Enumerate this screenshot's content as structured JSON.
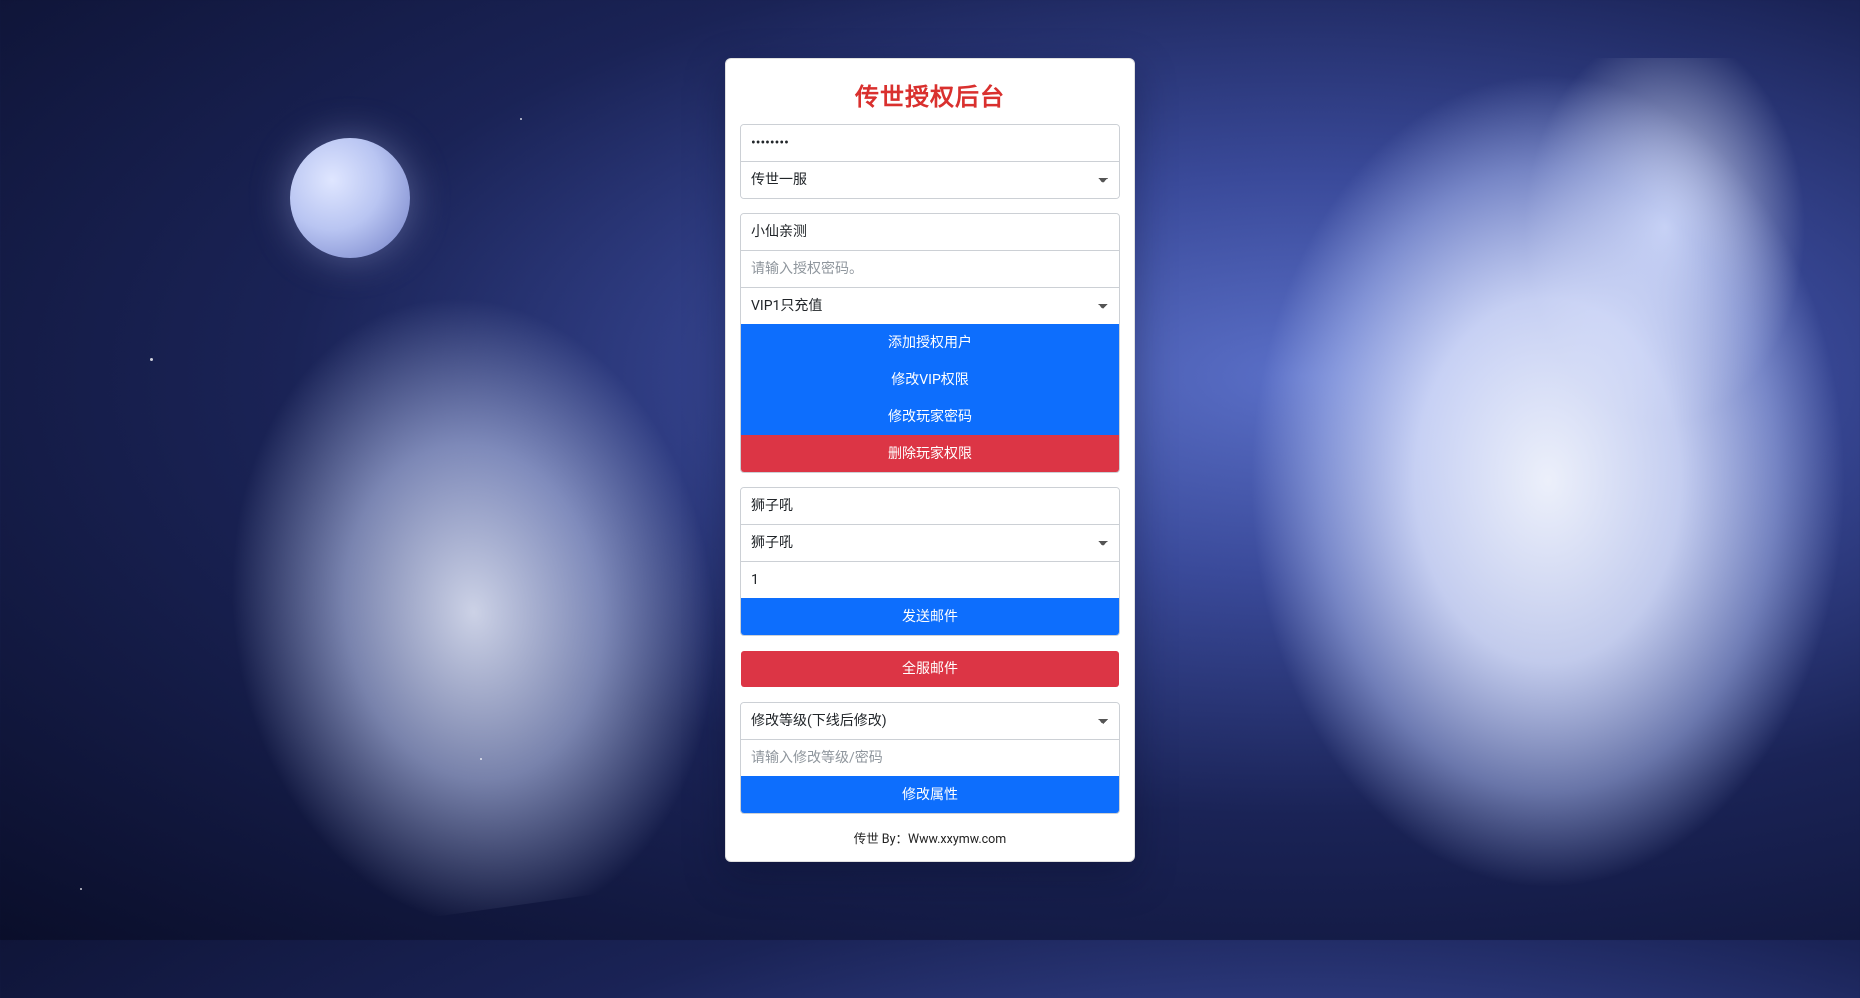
{
  "title": "传世授权后台",
  "section1": {
    "password_value": "••••••••",
    "server_select_value": "传世一服"
  },
  "section2": {
    "name_value": "小仙亲测",
    "auth_password_placeholder": "请输入授权密码。",
    "vip_select_value": "VIP1只充值",
    "btn_add_user": "添加授权用户",
    "btn_modify_vip": "修改VIP权限",
    "btn_change_pw": "修改玩家密码",
    "btn_delete_perm": "删除玩家权限"
  },
  "section3": {
    "item_name_value": "狮子吼",
    "item_select_value": "狮子吼",
    "qty_value": "1",
    "btn_send_mail": "发送邮件"
  },
  "section4": {
    "btn_global_mail": "全服邮件"
  },
  "section5": {
    "attr_select_value": "修改等级(下线后修改)",
    "attr_input_placeholder": "请输入修改等级/密码",
    "btn_modify_attr": "修改属性"
  },
  "footer": "传世 By：Www.xxymw.com"
}
